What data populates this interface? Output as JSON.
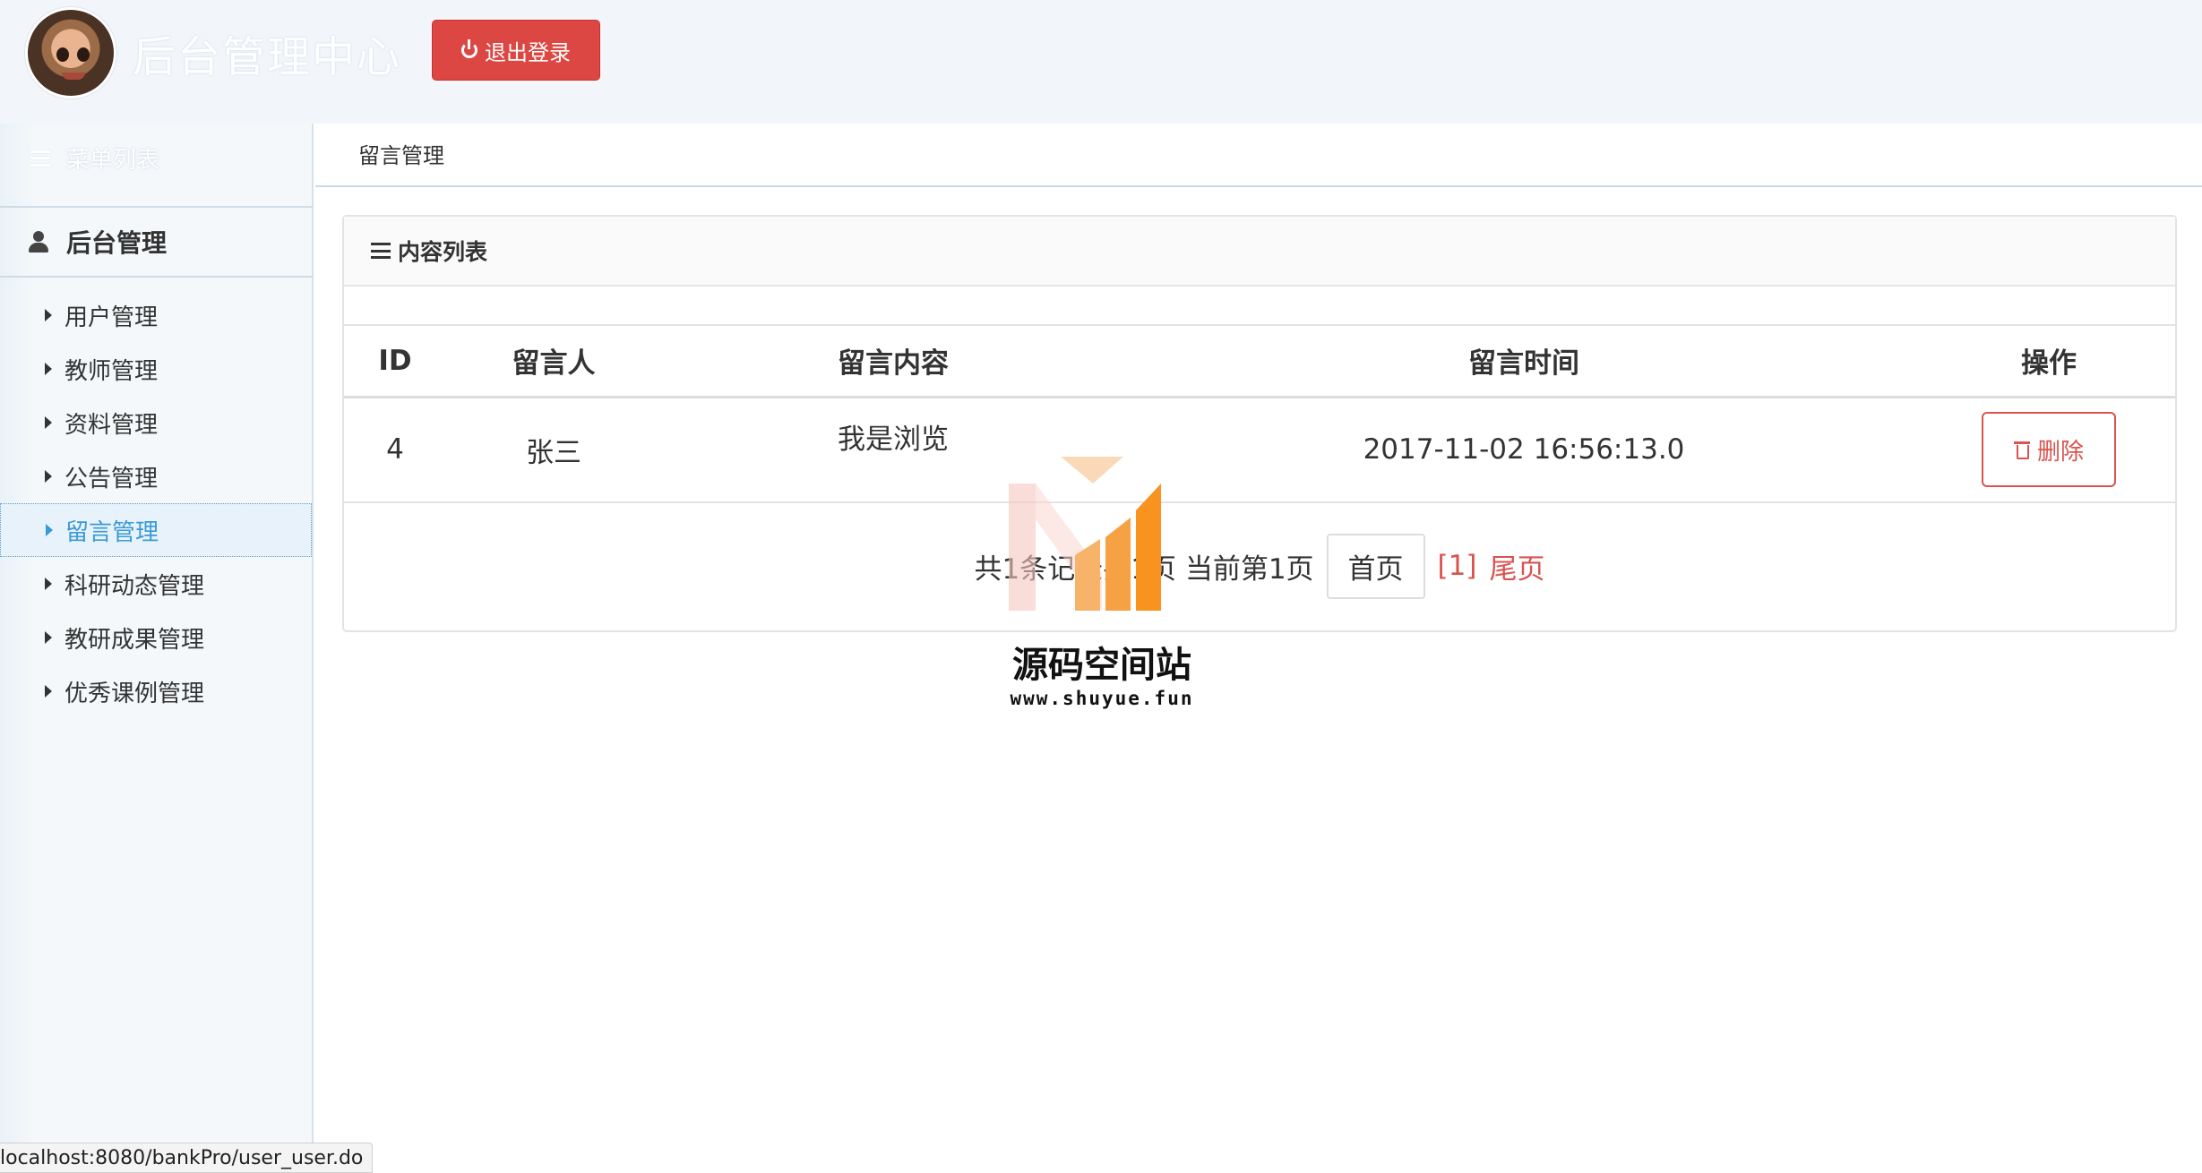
{
  "header": {
    "title": "后台管理中心",
    "logout_label": "退出登录"
  },
  "sidebar": {
    "menu_title": "菜单列表",
    "group_title": "后台管理",
    "items": [
      {
        "label": "用户管理"
      },
      {
        "label": "教师管理"
      },
      {
        "label": "资料管理"
      },
      {
        "label": "公告管理"
      },
      {
        "label": "留言管理",
        "active": true
      },
      {
        "label": " 科研动态管理"
      },
      {
        "label": "教研成果管理"
      },
      {
        "label": "优秀课例管理"
      }
    ]
  },
  "breadcrumb": "留言管理",
  "panel": {
    "title": "内容列表",
    "columns": [
      "ID",
      "留言人",
      "留言内容",
      "留言时间",
      "操作"
    ],
    "rows": [
      {
        "id": "4",
        "author": "张三",
        "content": "我是浏览",
        "time": "2017-11-02 16:56:13.0",
        "action": "删除"
      }
    ]
  },
  "pagination": {
    "summary": "共1条记录共1页 当前第1页",
    "first_label": "首页",
    "current_label": "[1]",
    "last_label": "尾页"
  },
  "watermark": {
    "name": "源码空间站",
    "url": "www.shuyue.fun"
  },
  "status_bar": {
    "url": "localhost:8080/bankPro/user_user.do"
  },
  "colors": {
    "logout_bg": "#dd4743",
    "active_nav": "#3a9ad6",
    "danger": "#d9534f",
    "watermark_orange": "#f7931e"
  }
}
